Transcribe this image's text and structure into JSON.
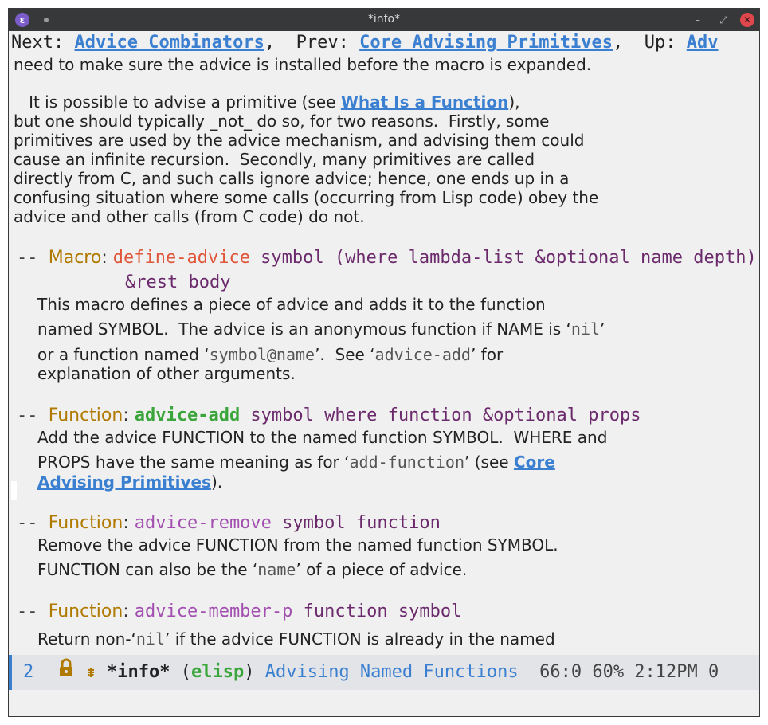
{
  "window": {
    "title": "*info*",
    "app_icon": "emacs-icon",
    "app_icon_glyph": "ε",
    "minimize_glyph": "–",
    "maximize_glyph": "⤢",
    "close_glyph": "✕"
  },
  "header": {
    "next_label": "Next: ",
    "next_link": "Advice Combinators",
    "sep1": ",  Prev: ",
    "prev_link": "Core Advising Primitives",
    "sep2": ",  Up: ",
    "up_link": "Adv"
  },
  "body": {
    "l1": "need to make sure the advice is installed before the macro is expanded.",
    "p2_pre": "   It is possible to advise a primitive (see ",
    "p2_link": "What Is a Function",
    "p2_post": "),",
    "l3": "but one should typically _not_ do so, for two reasons.  Firstly, some",
    "l4": "primitives are used by the advice mechanism, and advising them could",
    "l5": "cause an infinite recursion.  Secondly, many primitives are called",
    "l6": "directly from C, and such calls ignore advice; hence, one ends up in a",
    "l7": "confusing situation where some calls (occurring from Lisp code) obey the",
    "l8": "advice and other calls (from C code) do not.",
    "def1": {
      "dash": "-- ",
      "category": "Macro",
      "colon": ": ",
      "name": "define-advice",
      "args": " symbol (where lambda-list &optional name depth)",
      "args2": "&rest body",
      "d1": "This macro defines a piece of advice and adds it to the function",
      "d2_pre": "named SYMBOL.  The advice is an anonymous function if NAME is ‘",
      "d2_code": "nil",
      "d2_post": "’",
      "d3_pre": "or a function named ‘",
      "d3_code": "symbol@name",
      "d3_mid": "’.  See ‘",
      "d3_code2": "advice-add",
      "d3_post": "’ for",
      "d4": "explanation of other arguments."
    },
    "def2": {
      "dash": "-- ",
      "category": "Function",
      "colon": ": ",
      "name": "advice-add",
      "args": " symbol where function &optional props",
      "d1": "Add the advice FUNCTION to the named function SYMBOL.  WHERE and",
      "d2_pre": "PROPS have the same meaning as for ‘",
      "d2_code": "add-function",
      "d2_mid": "’ (see ",
      "d2_link": "Core",
      "d3_link": "Advising Primitives",
      "d3_post": ")."
    },
    "def3": {
      "dash": "-- ",
      "category": "Function",
      "colon": ": ",
      "name": "advice-remove",
      "args": " symbol function",
      "d1": "Remove the advice FUNCTION from the named function SYMBOL.",
      "d2_pre": "FUNCTION can also be the ‘",
      "d2_code": "name",
      "d2_post": "’ of a piece of advice."
    },
    "def4": {
      "dash": "-- ",
      "category": "Function",
      "colon": ": ",
      "name": "advice-member-p",
      "args": " function symbol",
      "d1_pre": "Return non-‘",
      "d1_code": "nil",
      "d1_post": "’ if the advice FUNCTION is already in the named"
    }
  },
  "modeline": {
    "window_number": "2",
    "lock_icon": "lock-icon",
    "narrow_icon": "narrow-icon",
    "narrow_glyph": "⇟",
    "buffer": "*info*",
    "mode_open": " (",
    "mode": "elisp",
    "mode_close": ") ",
    "node": "Advising Named Functions",
    "position": "  66:0 60% 2:12PM 0"
  },
  "colors": {
    "link": "#3b7fd1",
    "category": "#b07a00",
    "macro_name": "#e0563a",
    "function_name_green": "#3aa53a",
    "function_name_purple": "#a24fb0",
    "args": "#6b2a6b",
    "close_button": "#e0474c"
  }
}
